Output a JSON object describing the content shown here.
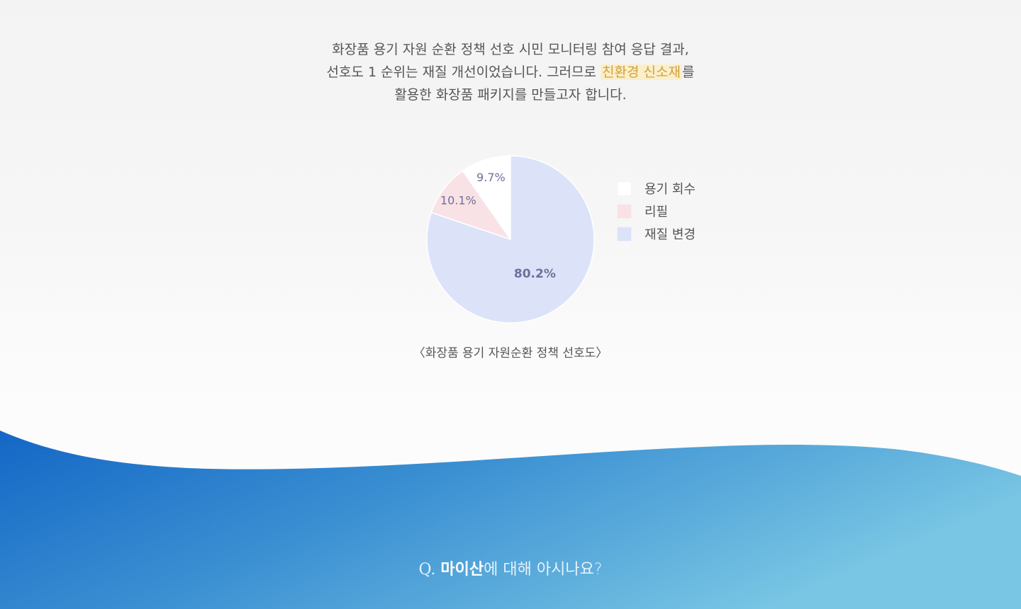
{
  "intro": {
    "line1": "화장품 용기 자원 순환 정책 선호 시민 모니터링 참여 응답 결과,",
    "line2_before": "선호도 1 순위는 재질 개선이었습니다. 그러므로 ",
    "line2_highlight": "친환경 신소재",
    "line2_after": "를",
    "line3": "활용한 화장품 패키지를 만들고자 합니다."
  },
  "chart_data": {
    "type": "pie",
    "title": "",
    "slices": [
      {
        "label": "용기 회수",
        "value": 9.7,
        "display": "9.7%",
        "color": "#ffffff"
      },
      {
        "label": "리필",
        "value": 10.1,
        "display": "10.1%",
        "color": "#f9e2e6"
      },
      {
        "label": "재질 변경",
        "value": 80.2,
        "display": "80.2%",
        "color": "#dce3f9"
      }
    ],
    "label_color": "#6f6f9b",
    "legend_position": "right"
  },
  "caption": "〈화장품 용기 자원순환 정책 선호도〉",
  "question": {
    "prefix": "Q.",
    "strong": "마이산",
    "rest": "에 대해 아시나요?"
  },
  "colors": {
    "wave_dark": "#1467c5",
    "wave_light": "#79c6e4",
    "highlight_bg": "#fbefc9",
    "highlight_text": "#d2a03a"
  }
}
